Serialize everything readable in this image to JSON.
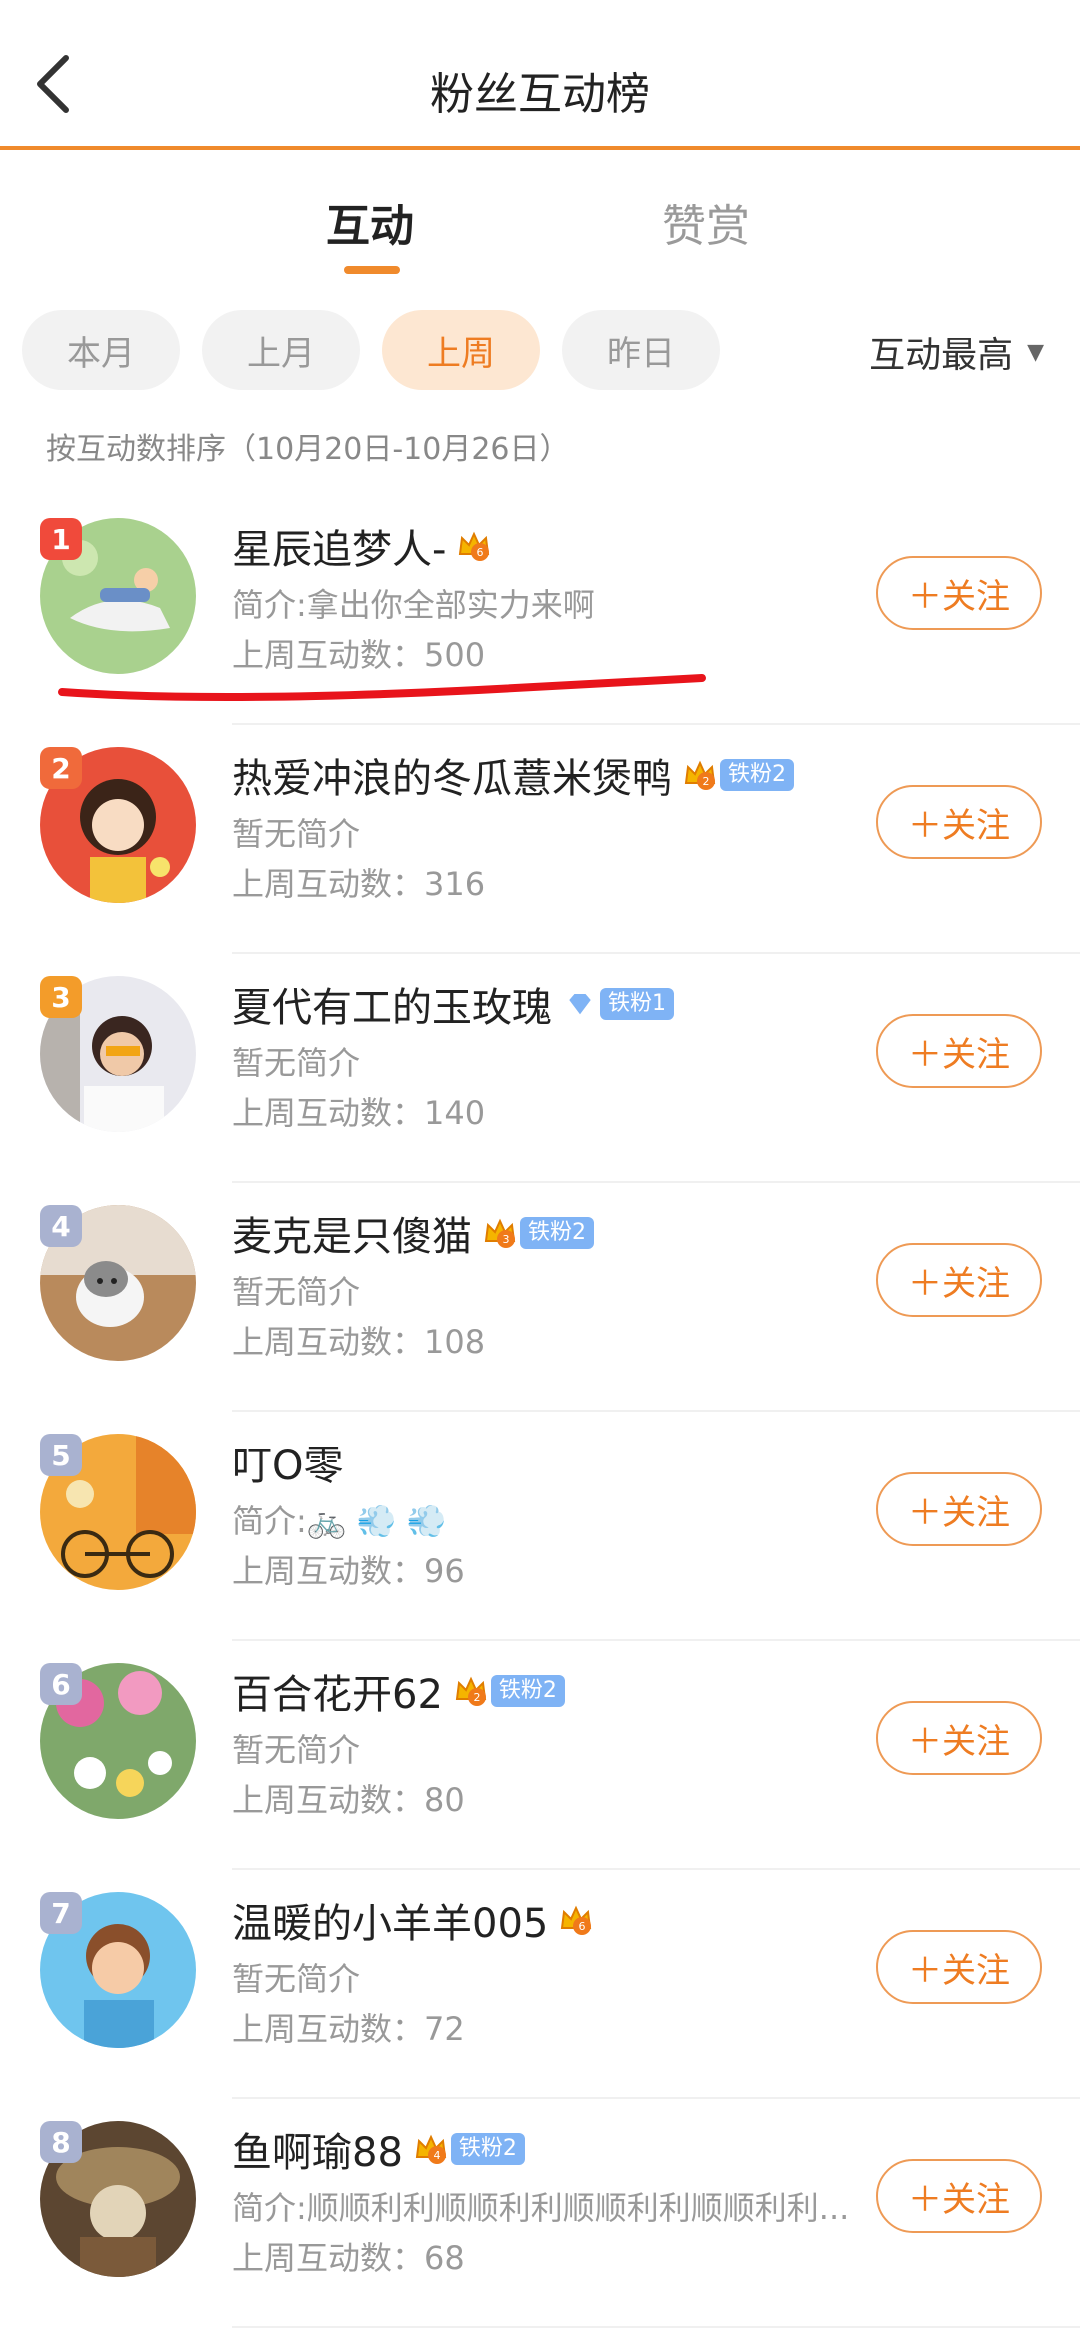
{
  "header": {
    "title": "粉丝互动榜"
  },
  "tabs": [
    {
      "label": "互动",
      "active": true
    },
    {
      "label": "赞赏",
      "active": false
    }
  ],
  "chips": [
    {
      "label": "本月",
      "selected": false
    },
    {
      "label": "上月",
      "selected": false
    },
    {
      "label": "上周",
      "selected": true
    },
    {
      "label": "昨日",
      "selected": false
    }
  ],
  "sort": {
    "label": "互动最高"
  },
  "sort_note": "按互动数排序（10月20日-10月26日）",
  "follow_label": "＋关注",
  "count_prefix": "上周互动数：",
  "colors": {
    "accent": "#f08a2c",
    "rank1": "#f04a3b",
    "rank2": "#f06a3b",
    "rank3": "#f39c2a",
    "rank_other": "#a9b2d0",
    "fan_badge": "#7fb3f5"
  },
  "fans": [
    {
      "rank": "1",
      "name": "星辰追梦人-",
      "crown": "6",
      "badge": "",
      "bio": "简介:拿出你全部实力来啊",
      "count": "500"
    },
    {
      "rank": "2",
      "name": "热爱冲浪的冬瓜薏米煲鸭",
      "crown": "2",
      "badge": "铁粉2",
      "bio": "暂无简介",
      "count": "316"
    },
    {
      "rank": "3",
      "name": "夏代有工的玉玫瑰",
      "crown": "",
      "badge": "铁粉1",
      "bio": "暂无简介",
      "count": "140"
    },
    {
      "rank": "4",
      "name": "麦克是只傻猫",
      "crown": "3",
      "badge": "铁粉2",
      "bio": "暂无简介",
      "count": "108"
    },
    {
      "rank": "5",
      "name": "叮O零",
      "crown": "",
      "badge": "",
      "bio": "简介:🚲 💨 💨",
      "count": "96"
    },
    {
      "rank": "6",
      "name": "百合花开62",
      "crown": "2",
      "badge": "铁粉2",
      "bio": "暂无简介",
      "count": "80"
    },
    {
      "rank": "7",
      "name": "温暖的小羊羊005",
      "crown": "6",
      "badge": "",
      "bio": "暂无简介",
      "count": "72"
    },
    {
      "rank": "8",
      "name": "鱼啊瑜88",
      "crown": "4",
      "badge": "铁粉2",
      "bio": "简介:顺顺利利顺顺利利顺顺利利顺顺利利...",
      "count": "68"
    }
  ]
}
